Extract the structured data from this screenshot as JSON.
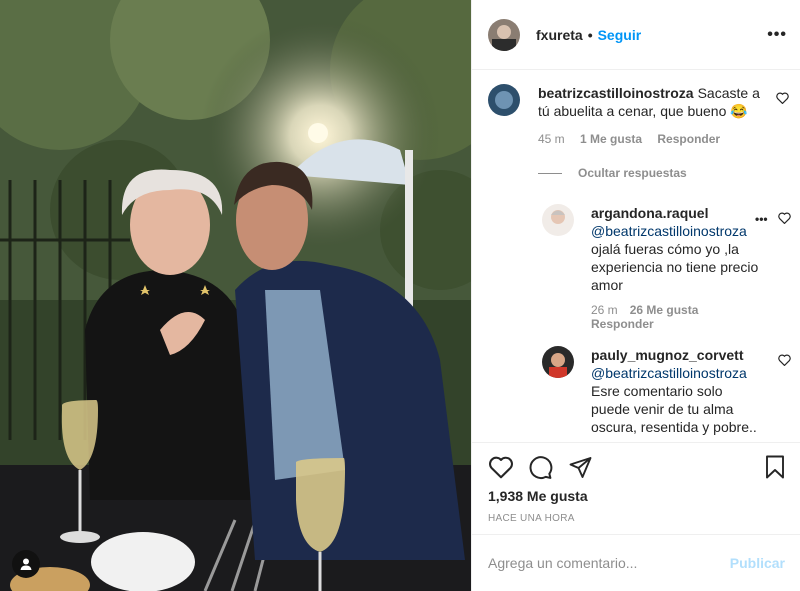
{
  "post": {
    "author": "fxureta",
    "follow_label": "Seguir",
    "separator": "•",
    "more_label": "•••",
    "likes": "1,938 Me gusta",
    "posted": "HACE UNA HORA"
  },
  "comments": [
    {
      "user": "beatrizcastilloinostroza",
      "text": "Sacaste a tú abuelita a cenar, que bueno 😂",
      "time": "45 m",
      "likes": "1 Me gusta",
      "reply": "Responder"
    }
  ],
  "hide_replies_label": "Ocultar respuestas",
  "replies": [
    {
      "user": "argandona.raquel",
      "mention": "@beatrizcastilloinostroza",
      "text": "ojalá fueras cómo yo ,la experiencia no tiene precio amor",
      "time": "26 m",
      "likes": "26 Me gusta",
      "reply": "Responder",
      "more_label": "•••"
    },
    {
      "user": "pauly_mugnoz_corvett",
      "mention": "@beatrizcastilloinostroza",
      "text": "Esre comentario solo puede venir de tu alma oscura, resentida y pobre..",
      "more_label": "•••"
    }
  ],
  "add_comment": {
    "placeholder": "Agrega un comentario...",
    "publish_label": "Publicar"
  },
  "icons": {
    "like": "heart-icon",
    "comment": "comment-icon",
    "share": "share-icon",
    "save": "bookmark-icon",
    "tag": "user-tag-icon"
  }
}
